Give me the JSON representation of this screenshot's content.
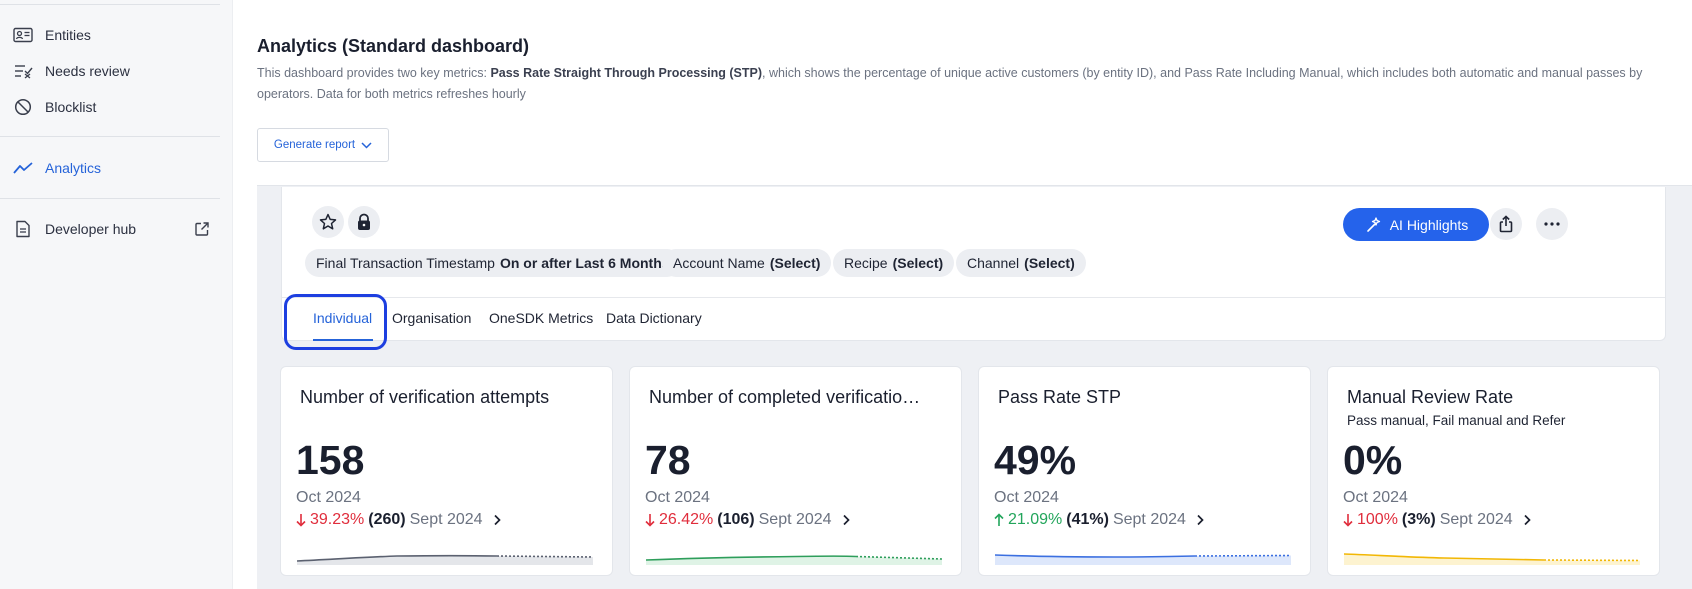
{
  "sidebar": {
    "items": [
      {
        "label": "Entities",
        "icon": "id-card-icon"
      },
      {
        "label": "Needs review",
        "icon": "review-list-icon"
      },
      {
        "label": "Blocklist",
        "icon": "block-icon"
      },
      {
        "label": "Analytics",
        "icon": "trend-line-icon",
        "active": true
      },
      {
        "label": "Developer hub",
        "icon": "document-icon",
        "trailing_icon": "external-link-icon"
      }
    ]
  },
  "header": {
    "title": "Analytics (Standard dashboard)",
    "description_prefix": "This dashboard provides two key metrics: ",
    "description_bold": "Pass Rate Straight Through Processing (STP)",
    "description_suffix": ", which shows the percentage of unique active customers (by entity ID), and Pass Rate Including Manual, which includes both automatic and manual passes by operators. Data for both metrics refreshes hourly",
    "generate_report_label": "Generate report"
  },
  "dashboard": {
    "ai_highlights_label": "AI Highlights",
    "filters": [
      {
        "label": "Final Transaction Timestamp",
        "value": "On or after Last 6 Months"
      },
      {
        "label": "Account Name",
        "value": "(Select)"
      },
      {
        "label": "Recipe",
        "value": "(Select)"
      },
      {
        "label": "Channel",
        "value": "(Select)"
      }
    ],
    "tabs": [
      {
        "label": "Individual",
        "active": true
      },
      {
        "label": "Organisation"
      },
      {
        "label": "OneSDK Metrics"
      },
      {
        "label": "Data Dictionary"
      }
    ],
    "cards": [
      {
        "title": "Number of verification attempts",
        "subtitle": "",
        "value": "158",
        "period": "Oct 2024",
        "delta_direction": "down",
        "delta_pct": "39.23%",
        "prev_value": "(260)",
        "prev_period": "Sept 2024",
        "spark_color": "#5b6170",
        "spark_fill": "#e4e6ea"
      },
      {
        "title": "Number of completed verificatio…",
        "subtitle": "",
        "value": "78",
        "period": "Oct 2024",
        "delta_direction": "down",
        "delta_pct": "26.42%",
        "prev_value": "(106)",
        "prev_period": "Sept 2024",
        "spark_color": "#2e9e5b",
        "spark_fill": "#dff3e6"
      },
      {
        "title": "Pass Rate STP",
        "subtitle": "",
        "value": "49%",
        "period": "Oct 2024",
        "delta_direction": "up",
        "delta_pct": "21.09%",
        "prev_value": "(41%)",
        "prev_period": "Sept 2024",
        "spark_color": "#3b6fe0",
        "spark_fill": "#dde7fb"
      },
      {
        "title": "Manual Review Rate",
        "subtitle": "Pass manual, Fail manual and Refer",
        "value": "0%",
        "period": "Oct 2024",
        "delta_direction": "down",
        "delta_pct": "100%",
        "prev_value": "(3%)",
        "prev_period": "Sept 2024",
        "spark_color": "#f2b705",
        "spark_fill": "#fdf3d0"
      }
    ]
  },
  "colors": {
    "accent": "#2563eb",
    "down": "#e02d3c",
    "up": "#22a55b",
    "focus_ring": "#1d3fe0"
  }
}
